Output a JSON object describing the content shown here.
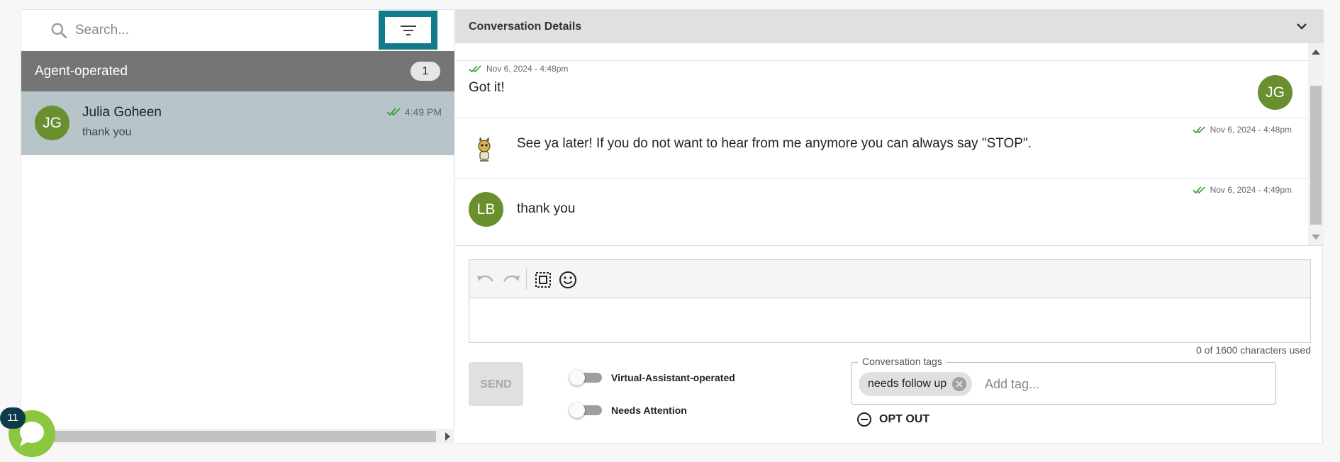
{
  "search": {
    "placeholder": "Search..."
  },
  "filter": {
    "icon": "filter-icon"
  },
  "group": {
    "title": "Agent-operated",
    "count": "1"
  },
  "conversations": [
    {
      "initials": "JG",
      "name": "Julia Goheen",
      "preview": "thank you",
      "time": "4:49 PM",
      "status_icon": "double-check-icon"
    }
  ],
  "chat_launcher": {
    "badge": "11"
  },
  "details": {
    "title": "Conversation Details"
  },
  "messages": [
    {
      "time": "Nov 6, 2024 - 4:48pm",
      "text": "Got it!",
      "avatar": "JG"
    },
    {
      "time": "Nov 6, 2024 - 4:48pm",
      "text": "See ya later! If you do not want to hear from me anymore you can always say \"STOP\".",
      "avatar_icon": "bot-mascot-icon"
    },
    {
      "time": "Nov 6, 2024 - 4:49pm",
      "text": "thank you",
      "avatar": "LB"
    }
  ],
  "composer": {
    "char_count": "0 of 1600 characters used"
  },
  "send": {
    "label": "SEND"
  },
  "toggles": {
    "virtual_assistant": "Virtual-Assistant-operated",
    "needs_attention": "Needs Attention"
  },
  "tags": {
    "legend": "Conversation tags",
    "items": [
      "needs follow up"
    ],
    "placeholder": "Add tag..."
  },
  "opt_out": {
    "label": "OPT OUT"
  },
  "colors": {
    "accent": "#117a8b",
    "avatar": "#6a8f2f",
    "check": "#3a9a3a",
    "launcher": "#8dc63f"
  }
}
